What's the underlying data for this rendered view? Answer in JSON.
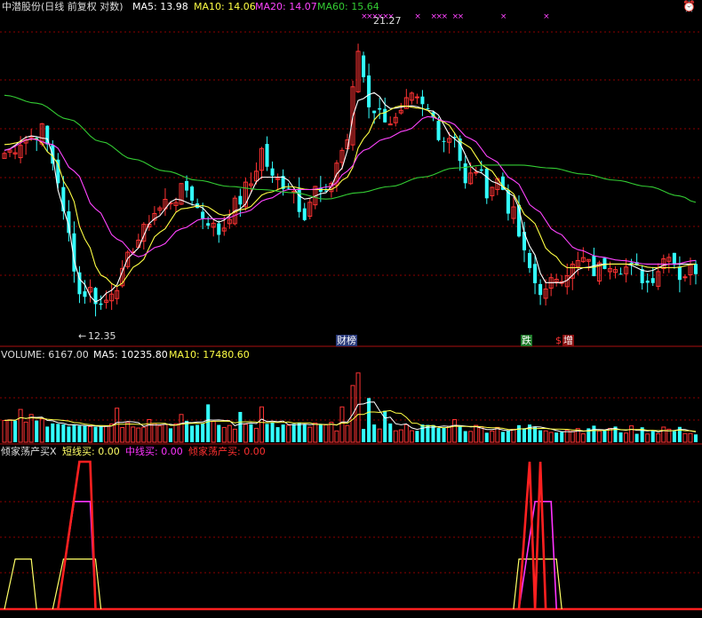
{
  "header": {
    "stock": "中潜股份(日线 前复权 对数)",
    "ma5": "MA5: 13.98",
    "ma10": "MA10: 14.06",
    "ma20": "MA20: 14.07",
    "ma60": "MA60: 15.64"
  },
  "volume_header": {
    "volume": "VOLUME: 6167.00",
    "ma5": "MA5: 10235.80",
    "ma10": "MA10: 17480.60"
  },
  "indicator_header": {
    "name": "倾家荡产买X",
    "short": "短线买: 0.00",
    "mid": "中线买: 0.00",
    "all": "倾家荡产买: 0.00"
  },
  "annotations": {
    "high_label": "21.27",
    "low_label": "12.35",
    "tag_caibang": "财榜",
    "tag_die": "跌",
    "tag_s": "$",
    "tag_zeng": "增"
  },
  "colors": {
    "up": "#ff3333",
    "down": "#33ffff",
    "ma5": "#ffffff",
    "ma10": "#ffff44",
    "ma20": "#ff44ff",
    "ma60": "#33cc33",
    "grid": "#8b0000",
    "short_line": "#ffff66",
    "mid_line": "#ff33ff",
    "all_line": "#ff2020"
  },
  "chart_data": [
    {
      "type": "candlestick",
      "scale": "log",
      "ylim": [
        12.0,
        22.5
      ],
      "x_count": 130,
      "high_marker": 21.27,
      "low_marker": 12.35,
      "anchors": [
        [
          0,
          17.1
        ],
        [
          4,
          17.6
        ],
        [
          7,
          17.9
        ],
        [
          9,
          16.8
        ],
        [
          12,
          14.5
        ],
        [
          14,
          12.9
        ],
        [
          16,
          13.0
        ],
        [
          18,
          12.6
        ],
        [
          21,
          13.2
        ],
        [
          25,
          14.4
        ],
        [
          28,
          15.2
        ],
        [
          31,
          15.6
        ],
        [
          34,
          15.9
        ],
        [
          37,
          15.1
        ],
        [
          40,
          14.6
        ],
        [
          43,
          15.4
        ],
        [
          46,
          16.1
        ],
        [
          48,
          17.2
        ],
        [
          50,
          16.2
        ],
        [
          53,
          16.1
        ],
        [
          56,
          15.2
        ],
        [
          58,
          15.9
        ],
        [
          60,
          15.6
        ],
        [
          62,
          16.8
        ],
        [
          64,
          17.6
        ],
        [
          66,
          21.0
        ],
        [
          68,
          18.9
        ],
        [
          70,
          18.5
        ],
        [
          73,
          18.2
        ],
        [
          76,
          19.0
        ],
        [
          79,
          18.6
        ],
        [
          82,
          17.6
        ],
        [
          84,
          17.8
        ],
        [
          86,
          16.0
        ],
        [
          88,
          16.6
        ],
        [
          90,
          15.9
        ],
        [
          92,
          16.2
        ],
        [
          95,
          15.1
        ],
        [
          97,
          13.9
        ],
        [
          99,
          13.2
        ],
        [
          101,
          12.9
        ],
        [
          103,
          13.4
        ],
        [
          106,
          13.6
        ],
        [
          108,
          13.8
        ],
        [
          110,
          13.5
        ],
        [
          113,
          13.8
        ],
        [
          116,
          13.6
        ],
        [
          118,
          13.5
        ],
        [
          120,
          13.2
        ],
        [
          122,
          13.6
        ],
        [
          124,
          14.1
        ],
        [
          126,
          13.4
        ],
        [
          129,
          13.6
        ]
      ],
      "ma_series": [
        {
          "name": "MA5",
          "anchors": [
            [
              0,
              17.2
            ],
            [
              5,
              17.7
            ],
            [
              8,
              17.6
            ],
            [
              11,
              15.3
            ],
            [
              14,
              13.3
            ],
            [
              17,
              12.7
            ],
            [
              20,
              13.0
            ],
            [
              24,
              14.0
            ],
            [
              28,
              15.0
            ],
            [
              32,
              15.6
            ],
            [
              36,
              15.4
            ],
            [
              40,
              14.9
            ],
            [
              44,
              15.3
            ],
            [
              48,
              16.3
            ],
            [
              52,
              16.3
            ],
            [
              56,
              15.6
            ],
            [
              60,
              15.8
            ],
            [
              63,
              16.6
            ],
            [
              66,
              19.0
            ],
            [
              69,
              19.3
            ],
            [
              72,
              18.7
            ],
            [
              76,
              18.8
            ],
            [
              80,
              18.6
            ],
            [
              84,
              17.6
            ],
            [
              88,
              16.5
            ],
            [
              92,
              16.1
            ],
            [
              95,
              15.7
            ],
            [
              98,
              14.2
            ],
            [
              101,
              13.2
            ],
            [
              104,
              13.2
            ],
            [
              108,
              13.6
            ],
            [
              112,
              13.7
            ],
            [
              116,
              13.7
            ],
            [
              120,
              13.5
            ],
            [
              124,
              13.7
            ],
            [
              129,
              13.7
            ]
          ]
        },
        {
          "name": "MA10",
          "anchors": [
            [
              0,
              17.4
            ],
            [
              6,
              17.6
            ],
            [
              9,
              17.0
            ],
            [
              12,
              15.9
            ],
            [
              15,
              14.4
            ],
            [
              18,
              13.4
            ],
            [
              21,
              13.1
            ],
            [
              25,
              13.7
            ],
            [
              29,
              14.6
            ],
            [
              33,
              15.3
            ],
            [
              37,
              15.4
            ],
            [
              41,
              15.1
            ],
            [
              45,
              15.3
            ],
            [
              49,
              15.8
            ],
            [
              53,
              16.0
            ],
            [
              57,
              15.9
            ],
            [
              61,
              15.9
            ],
            [
              64,
              16.3
            ],
            [
              67,
              17.6
            ],
            [
              70,
              18.5
            ],
            [
              74,
              18.8
            ],
            [
              78,
              18.7
            ],
            [
              82,
              18.2
            ],
            [
              86,
              17.4
            ],
            [
              90,
              16.6
            ],
            [
              94,
              15.9
            ],
            [
              98,
              15.0
            ],
            [
              102,
              14.0
            ],
            [
              105,
              13.6
            ],
            [
              109,
              13.6
            ],
            [
              113,
              13.7
            ],
            [
              117,
              13.7
            ],
            [
              121,
              13.6
            ],
            [
              125,
              13.6
            ],
            [
              129,
              13.7
            ]
          ]
        },
        {
          "name": "MA20",
          "anchors": [
            [
              0,
              17.2
            ],
            [
              5,
              17.6
            ],
            [
              9,
              17.4
            ],
            [
              13,
              16.5
            ],
            [
              17,
              15.3
            ],
            [
              21,
              14.4
            ],
            [
              25,
              13.9
            ],
            [
              29,
              14.2
            ],
            [
              33,
              14.7
            ],
            [
              37,
              15.0
            ],
            [
              41,
              15.0
            ],
            [
              45,
              15.2
            ],
            [
              49,
              15.6
            ],
            [
              53,
              15.9
            ],
            [
              57,
              15.9
            ],
            [
              61,
              16.0
            ],
            [
              64,
              16.5
            ],
            [
              67,
              17.2
            ],
            [
              71,
              17.6
            ],
            [
              75,
              17.9
            ],
            [
              79,
              18.4
            ],
            [
              83,
              18.2
            ],
            [
              87,
              17.6
            ],
            [
              91,
              16.9
            ],
            [
              95,
              16.2
            ],
            [
              99,
              15.3
            ],
            [
              103,
              14.6
            ],
            [
              107,
              14.1
            ],
            [
              111,
              13.9
            ],
            [
              115,
              13.8
            ],
            [
              120,
              13.7
            ],
            [
              125,
              13.7
            ],
            [
              129,
              13.8
            ]
          ]
        },
        {
          "name": "MA60",
          "anchors": [
            [
              0,
              19.2
            ],
            [
              6,
              18.9
            ],
            [
              12,
              18.3
            ],
            [
              18,
              17.5
            ],
            [
              24,
              16.9
            ],
            [
              30,
              16.5
            ],
            [
              36,
              16.2
            ],
            [
              42,
              16.0
            ],
            [
              48,
              15.9
            ],
            [
              54,
              15.8
            ],
            [
              60,
              15.6
            ],
            [
              66,
              15.8
            ],
            [
              72,
              16.0
            ],
            [
              78,
              16.3
            ],
            [
              84,
              16.6
            ],
            [
              90,
              16.7
            ],
            [
              96,
              16.7
            ],
            [
              102,
              16.6
            ],
            [
              108,
              16.4
            ],
            [
              114,
              16.2
            ],
            [
              120,
              16.0
            ],
            [
              126,
              15.7
            ],
            [
              129,
              15.5
            ]
          ]
        }
      ]
    },
    {
      "type": "bar",
      "series_name": "VOLUME",
      "ylim": [
        0,
        62000
      ],
      "last_value": 6167,
      "ma5_last": 10235.8,
      "ma10_last": 17480.6,
      "spikes": [
        [
          3,
          26000
        ],
        [
          5,
          22000
        ],
        [
          21,
          27000
        ],
        [
          27,
          18000
        ],
        [
          33,
          22000
        ],
        [
          38,
          30000
        ],
        [
          44,
          24000
        ],
        [
          48,
          28000
        ],
        [
          63,
          28000
        ],
        [
          65,
          45000
        ],
        [
          66,
          55000
        ],
        [
          68,
          35000
        ],
        [
          71,
          25000
        ],
        [
          84,
          18000
        ],
        [
          98,
          14000
        ],
        [
          109,
          11000
        ],
        [
          123,
          12000
        ]
      ]
    },
    {
      "type": "line",
      "ylim": [
        0,
        100
      ],
      "series": [
        {
          "name": "短线买",
          "segments": [
            [
              [
                0,
                0
              ],
              [
                2,
                34
              ],
              [
                5,
                34
              ],
              [
                6,
                0
              ]
            ],
            [
              [
                9,
                0
              ],
              [
                11,
                34
              ],
              [
                14,
                34
              ],
              [
                17,
                34
              ],
              [
                18,
                0
              ]
            ],
            [
              [
                95,
                0
              ],
              [
                96,
                34
              ],
              [
                103,
                34
              ],
              [
                104,
                0
              ]
            ]
          ]
        },
        {
          "name": "中线买",
          "segments": [
            [
              [
                10,
                0
              ],
              [
                13,
                73
              ],
              [
                16,
                73
              ],
              [
                17,
                0
              ]
            ],
            [
              [
                96,
                0
              ],
              [
                99,
                73
              ],
              [
                102,
                73
              ],
              [
                103,
                0
              ]
            ]
          ]
        },
        {
          "name": "倾家荡产买",
          "segments": [
            [
              [
                10,
                0
              ],
              [
                14,
                100
              ],
              [
                16,
                100
              ],
              [
                17,
                0
              ]
            ],
            [
              [
                96,
                0
              ],
              [
                98,
                100
              ],
              [
                99,
                0
              ],
              [
                100,
                100
              ],
              [
                101,
                0
              ]
            ]
          ]
        }
      ]
    }
  ]
}
